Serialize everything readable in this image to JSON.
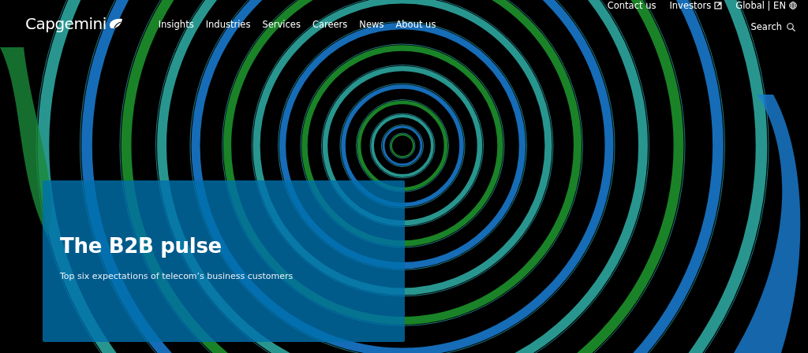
{
  "header": {
    "logo": "Capgemini",
    "nav": [
      "Insights",
      "Industries",
      "Services",
      "Careers",
      "News",
      "About us"
    ],
    "utility": [
      {
        "label": "Contact us",
        "kind": "link"
      },
      {
        "label": "Investors",
        "kind": "external"
      },
      {
        "label": "Global | EN",
        "kind": "language"
      }
    ],
    "search": "Search"
  },
  "hero": {
    "title": "The B2B pulse",
    "subtitle": "Top six expectations of telecom’s business customers"
  }
}
